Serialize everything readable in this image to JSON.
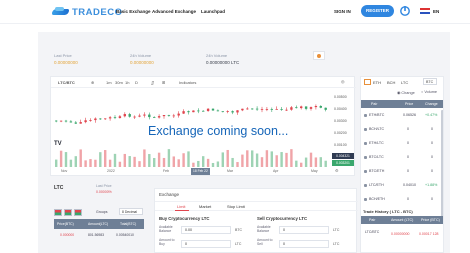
{
  "nav": {
    "logo_text": "TRADECO",
    "links": [
      "Basic Exchange",
      "Advanced Exchange",
      "Launchpad"
    ],
    "sign_in": "SIGN IN",
    "register": "REGISTER",
    "lang": "EN"
  },
  "stats": {
    "last_price_label": "Last Price",
    "last_price": "0.00000000",
    "volume_label": "24h Volume",
    "volume": "0.00000000",
    "change_label": "24h Volume",
    "change": "0.00000000 LTC"
  },
  "chart": {
    "pair": "LTC/BTC",
    "toolbar_items": [
      "1m",
      "30m",
      "1h",
      "D",
      "Indicators"
    ],
    "price_ticks": [
      "0.00500",
      "0.00400",
      "0.00300",
      "0.00200",
      "0.00100",
      "0.00000"
    ],
    "highlight_1": "0.004321",
    "highlight_2": "0.003201",
    "time_ticks": [
      "Nov",
      "2022",
      "Feb",
      "Mar",
      "Apr",
      "May"
    ],
    "current_time": "18 Feb 22",
    "tv_badge": "TV",
    "overlay": "Exchange coming soon..."
  },
  "market": {
    "tabs": [
      "ETH",
      "BCH",
      "LTC"
    ],
    "select_value": "BTC",
    "toggle_change": "Change",
    "toggle_volume": "Volume",
    "columns": [
      "Pair",
      "Price",
      "Change"
    ],
    "rows": [
      {
        "pair": "ETH/BTC",
        "price": "0.06526",
        "change": "+0.47%"
      },
      {
        "pair": "BCH/LTC",
        "price": "0",
        "change": "0"
      },
      {
        "pair": "ETH/LTC",
        "price": "0",
        "change": "0"
      },
      {
        "pair": "BTC/LTC",
        "price": "0",
        "change": "0"
      },
      {
        "pair": "BTC/ETH",
        "price": "0",
        "change": "0"
      },
      {
        "pair": "LTC/ETH",
        "price": "0.04010",
        "change": "+1.88%"
      },
      {
        "pair": "BCH/ETH",
        "price": "0",
        "change": "0"
      }
    ],
    "trade_history_title": "Trade History ( LTC - BTC)",
    "trade_columns": [
      "Pair",
      "Amount (LTC)",
      "Price (BTC)"
    ],
    "trade_row": {
      "pair": "LTC/BTC",
      "amount": "0.00000000",
      "price": "0.00017 128"
    }
  },
  "orderbook": {
    "title": "LTC",
    "sub_label": "Last Price",
    "change": "0.00000%",
    "groups_label": "Groups",
    "groups_value": "8 Decimal",
    "columns": [
      "Price(BTC)",
      "Amount(LTC)",
      "Total(BTC)"
    ],
    "row": {
      "price": "0.000000",
      "amount": "801.56983",
      "total": "0.00540010"
    }
  },
  "exchange": {
    "title": "Exchange",
    "tabs": [
      "Limit",
      "Market",
      "Stop Limit"
    ],
    "buy_title": "Buy Cryptocurrency LTC",
    "sell_title": "Sell Cryptocurrency LTC",
    "available_label": "Available Balance",
    "amount_label": "Amount to Buy",
    "amount_sell_label": "Amount to Sell",
    "buy_available": "0.00",
    "buy_amount": "0",
    "sell_available": "0",
    "sell_amount": "0",
    "unit_btc": "BTC",
    "unit_ltc": "LTC"
  },
  "colors": {
    "accent_blue": "#2f86e0",
    "header_slate": "#6e7f96",
    "up_green": "#3aa76d",
    "down_red": "#e0454e"
  }
}
